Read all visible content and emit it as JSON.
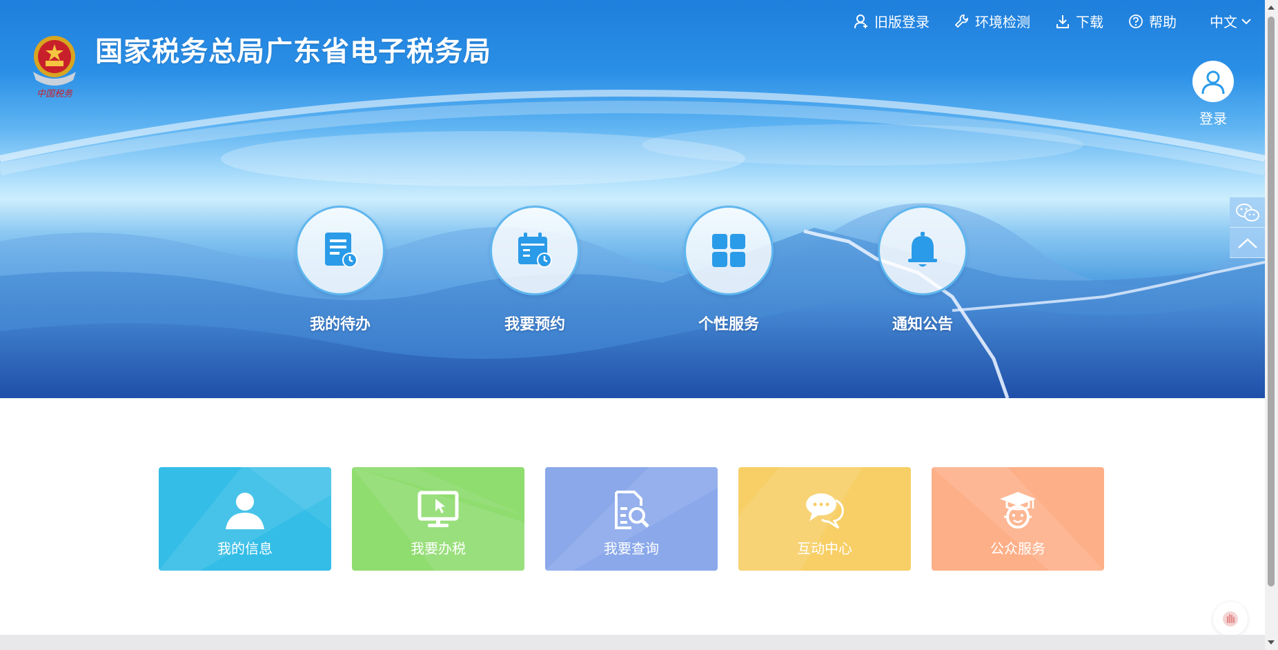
{
  "header": {
    "site_title": "国家税务总局广东省电子税务局",
    "nav": [
      {
        "label": "旧版登录",
        "icon": "user-plus-icon"
      },
      {
        "label": "环境检测",
        "icon": "wrench-icon"
      },
      {
        "label": "下载",
        "icon": "download-icon"
      },
      {
        "label": "帮助",
        "icon": "help-circle-icon"
      }
    ],
    "language": "中文",
    "login_label": "登录"
  },
  "quick_links": [
    {
      "label": "我的待办",
      "icon": "todo-document-icon"
    },
    {
      "label": "我要预约",
      "icon": "calendar-clock-icon"
    },
    {
      "label": "个性服务",
      "icon": "grid-icon"
    },
    {
      "label": "通知公告",
      "icon": "bell-icon"
    }
  ],
  "cards": [
    {
      "label": "我的信息",
      "icon": "person-icon",
      "color": "#33bde7"
    },
    {
      "label": "我要办税",
      "icon": "monitor-cursor-icon",
      "color": "#8fdc6f"
    },
    {
      "label": "我要查询",
      "icon": "document-search-icon",
      "color": "#8aa8ea"
    },
    {
      "label": "互动中心",
      "icon": "chat-bubbles-icon",
      "color": "#f7cf66"
    },
    {
      "label": "公众服务",
      "icon": "graduate-icon",
      "color": "#fdaf88"
    }
  ],
  "colors": {
    "accent": "#1f7fdc",
    "icon_blue": "#2a9be8"
  }
}
